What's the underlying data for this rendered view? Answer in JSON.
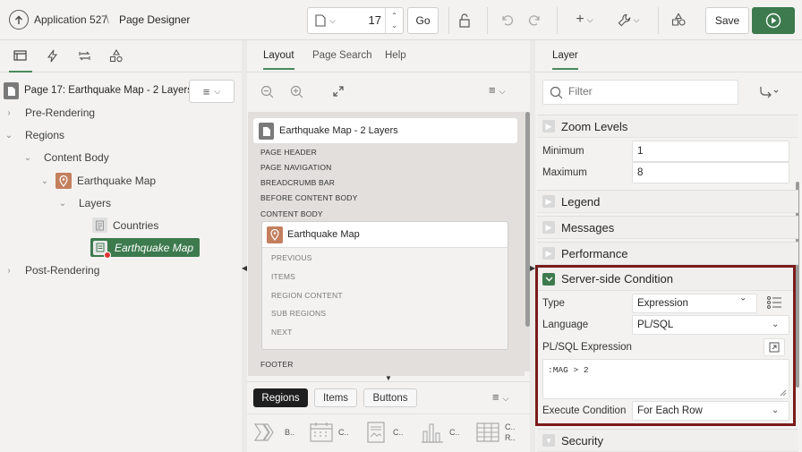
{
  "header": {
    "app_label": "Application 527",
    "separator": "\\",
    "page_designer": "Page Designer",
    "page_number": "17",
    "go_label": "Go",
    "save_label": "Save"
  },
  "left": {
    "page_title": "Page 17: Earthquake Map - 2 Layers",
    "tree": {
      "pre_rendering": "Pre-Rendering",
      "regions": "Regions",
      "content_body": "Content Body",
      "earthquake_map": "Earthquake Map",
      "layers": "Layers",
      "countries": "Countries",
      "earthquake_map_layer": "Earthquake Map",
      "post_rendering": "Post-Rendering"
    }
  },
  "middle": {
    "tabs": [
      "Layout",
      "Page Search",
      "Help"
    ],
    "page_card_title": "Earthquake Map - 2 Layers",
    "positions": [
      "PAGE HEADER",
      "PAGE NAVIGATION",
      "BREADCRUMB BAR",
      "BEFORE CONTENT BODY",
      "CONTENT BODY"
    ],
    "region_title": "Earthquake Map",
    "region_slots": [
      "PREVIOUS",
      "ITEMS",
      "REGION CONTENT",
      "SUB REGIONS",
      "NEXT"
    ],
    "footer": "FOOTER",
    "gallery_tabs": [
      "Regions",
      "Items",
      "Buttons"
    ],
    "gallery_items": [
      "B..",
      "C..",
      "C..",
      "C..",
      "C..",
      "R.."
    ]
  },
  "right": {
    "tab": "Layer",
    "filter_placeholder": "Filter",
    "zoom_levels": {
      "title": "Zoom Levels",
      "min_label": "Minimum",
      "min_value": "1",
      "max_label": "Maximum",
      "max_value": "8"
    },
    "collapsed_groups": [
      "Legend",
      "Messages",
      "Performance"
    ],
    "server_side": {
      "title": "Server-side Condition",
      "type_label": "Type",
      "type_value": "Expression",
      "language_label": "Language",
      "language_value": "PL/SQL",
      "expr_label": "PL/SQL Expression",
      "expr_value": ":MAG > 2",
      "exec_label": "Execute Condition",
      "exec_value": "For Each Row"
    },
    "security": "Security"
  },
  "colors": {
    "accent": "#3d7a4e",
    "highlight_border": "#7a1b1b",
    "map_icon": "#c47f5e"
  }
}
